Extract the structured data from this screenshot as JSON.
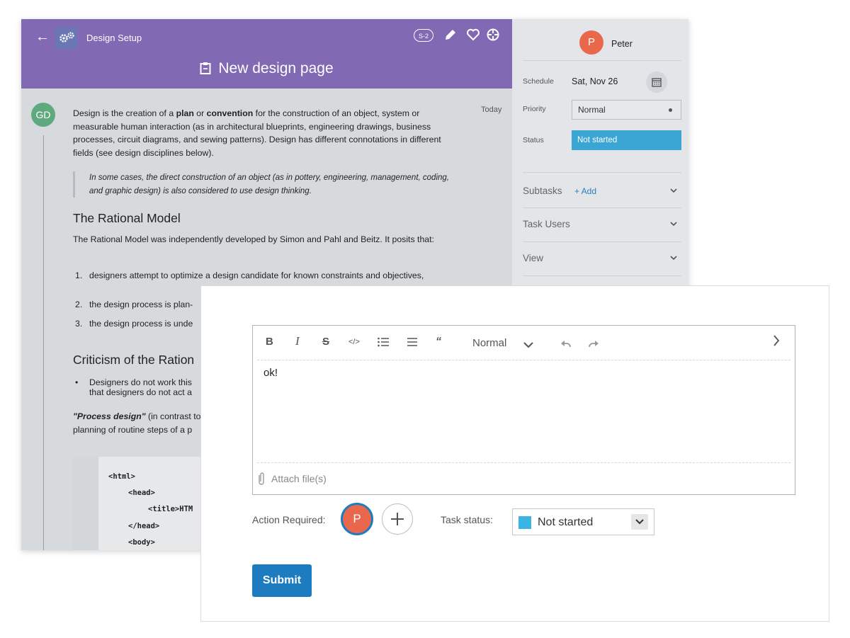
{
  "header": {
    "back_icon": "arrow-left-icon",
    "breadcrumb": "Design Setup",
    "badge": "S-2",
    "title": "New design page"
  },
  "post": {
    "author_initials": "GD",
    "timestamp": "Today",
    "intro_before_plan": "Design is the creation of a ",
    "intro_plan": "plan",
    "intro_or": " or ",
    "intro_convention": "convention",
    "intro_after": " for the construction of an object, system or measurable human interaction (as in architectural blueprints, engineering drawings, business processes, circuit diagrams, and sewing patterns). Design has different connotations in different fields (see design disciplines below).",
    "quote": "In some cases, the direct construction of an object (as in pottery, engineering, management, coding, and graphic design) is also considered to use design thinking.",
    "heading_rational": "The Rational Model",
    "rational_para": "The Rational Model was independently developed by Simon and Pahl and Beitz. It posits that:",
    "list_items": [
      {
        "num": "1.",
        "text": "designers attempt to optimize a design candidate for known constraints and objectives,"
      },
      {
        "num": "2.",
        "text": "the design process is plan-"
      },
      {
        "num": "3.",
        "text": "the design process is unde"
      }
    ],
    "heading_criticism": "Criticism of the Ration",
    "bullet_item": "Designers do not work this that designers do not act a",
    "process_bold": "\"Process design\"",
    "process_rest": " (in contrast to",
    "process_line2": "planning of routine steps of a p",
    "code_lines": [
      "<html>",
      "<head>",
      "<title>HTM",
      "</head>",
      "<body>"
    ]
  },
  "side": {
    "user_initial": "P",
    "user_name": "Peter",
    "schedule_label": "Schedule",
    "schedule_value": "Sat, Nov 26",
    "priority_label": "Priority",
    "priority_value": "Normal",
    "status_label": "Status",
    "status_value": "Not started",
    "status_color": "#3ba6d4",
    "subtasks_label": "Subtasks",
    "add_label": "+ Add",
    "task_users_label": "Task Users",
    "view_label": "View"
  },
  "comment": {
    "toolbar": {
      "bold": "B",
      "italic": "I",
      "strike": "S",
      "code": "</>",
      "format_value": "Normal"
    },
    "text": "ok!",
    "attach_label": "Attach file(s)",
    "action_required_label": "Action Required:",
    "assignee_initial": "P",
    "task_status_label": "Task status:",
    "task_status_value": "Not started",
    "task_status_color": "#3bb3e3",
    "submit_label": "Submit"
  },
  "colors": {
    "header_purple": "#8169b4",
    "accent_blue": "#1d7bbf",
    "avatar_orange": "#e9684c",
    "avatar_green": "#5eaa7e"
  }
}
